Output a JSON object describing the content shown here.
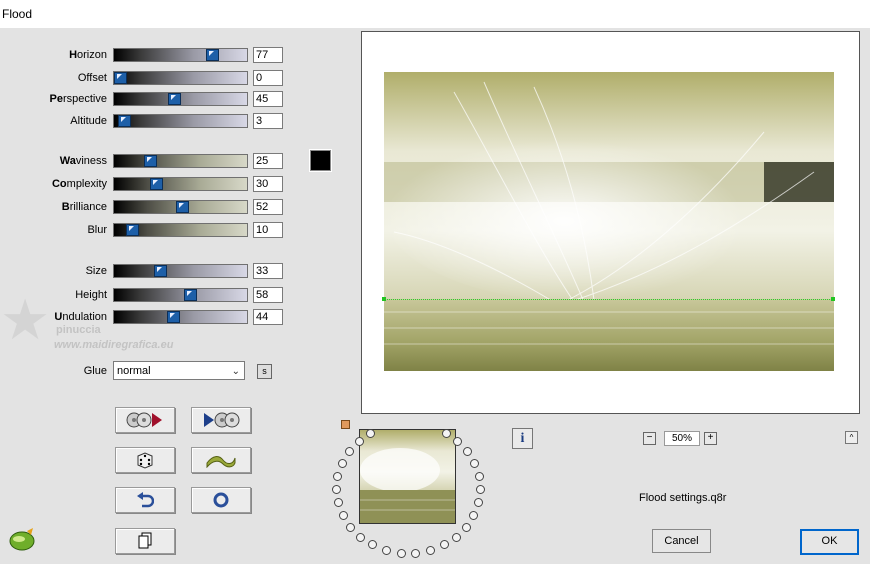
{
  "window": {
    "title": "Flood"
  },
  "params": [
    {
      "label": "Horizon",
      "bold_prefix": "H",
      "rest": "orizon",
      "value": "77",
      "fraction": 0.77
    },
    {
      "label": "Offset",
      "bold_prefix": "",
      "rest": "Offset",
      "value": "0",
      "fraction": 0.0
    },
    {
      "label": "Perspective",
      "bold_prefix": "Pe",
      "rest": "rspective",
      "value": "45",
      "fraction": 0.45
    },
    {
      "label": "Altitude",
      "bold_prefix": "",
      "rest": "Altitude",
      "value": "3",
      "fraction": 0.03
    },
    {
      "label": "Waviness",
      "bold_prefix": "Wa",
      "rest": "viness",
      "value": "25",
      "fraction": 0.25
    },
    {
      "label": "Complexity",
      "bold_prefix": "Co",
      "rest": "mplexity",
      "value": "30",
      "fraction": 0.3
    },
    {
      "label": "Brilliance",
      "bold_prefix": "B",
      "rest": "rilliance",
      "value": "52",
      "fraction": 0.52
    },
    {
      "label": "Blur",
      "bold_prefix": "",
      "rest": "Blur",
      "value": "10",
      "fraction": 0.1
    },
    {
      "label": "Size",
      "bold_prefix": "",
      "rest": "Size",
      "value": "33",
      "fraction": 0.33
    },
    {
      "label": "Height",
      "bold_prefix": "",
      "rest": "Height",
      "value": "58",
      "fraction": 0.58
    },
    {
      "label": "Undulation",
      "bold_prefix": "U",
      "rest": "ndulation",
      "value": "44",
      "fraction": 0.44
    }
  ],
  "glue": {
    "label": "Glue",
    "value": "normal"
  },
  "color_swatch": "#000000",
  "watermark": {
    "name": "pinuccia",
    "url": "www.maidiregrafica.eu"
  },
  "zoom": {
    "value": "50%"
  },
  "settings_file": "Flood settings.q8r",
  "buttons": {
    "cancel": "Cancel",
    "ok": "OK"
  },
  "colors": {
    "accent": "#1d5fa8",
    "ok_border": "#0066cc",
    "horizon_line": "#2ccf2c"
  }
}
